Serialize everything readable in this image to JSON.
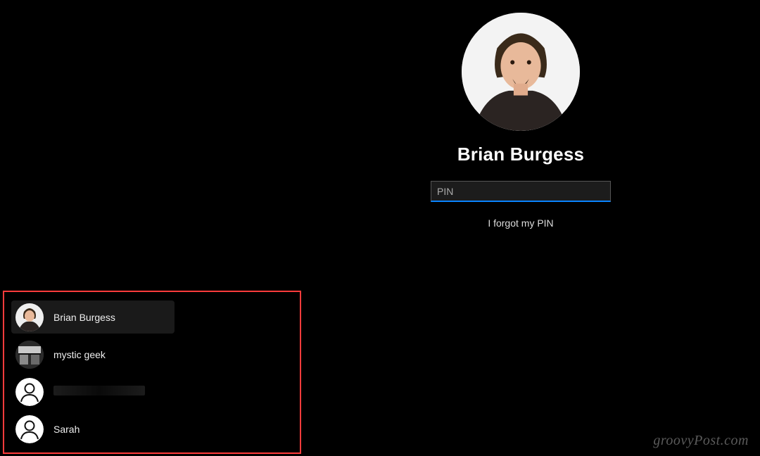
{
  "login": {
    "active_user_name": "Brian Burgess",
    "pin_placeholder": "PIN",
    "forgot_pin_label": "I forgot my PIN",
    "accent_color": "#0a84ff"
  },
  "user_list": {
    "highlight_border_color": "#ff3b3b",
    "items": [
      {
        "label": "Brian Burgess",
        "avatar": "photo-brian",
        "selected": true
      },
      {
        "label": "mystic geek",
        "avatar": "photo-desk",
        "selected": false
      },
      {
        "label": "",
        "avatar": "generic",
        "selected": false,
        "redacted": true
      },
      {
        "label": "Sarah",
        "avatar": "generic",
        "selected": false
      }
    ]
  },
  "watermark": "groovyPost.com"
}
